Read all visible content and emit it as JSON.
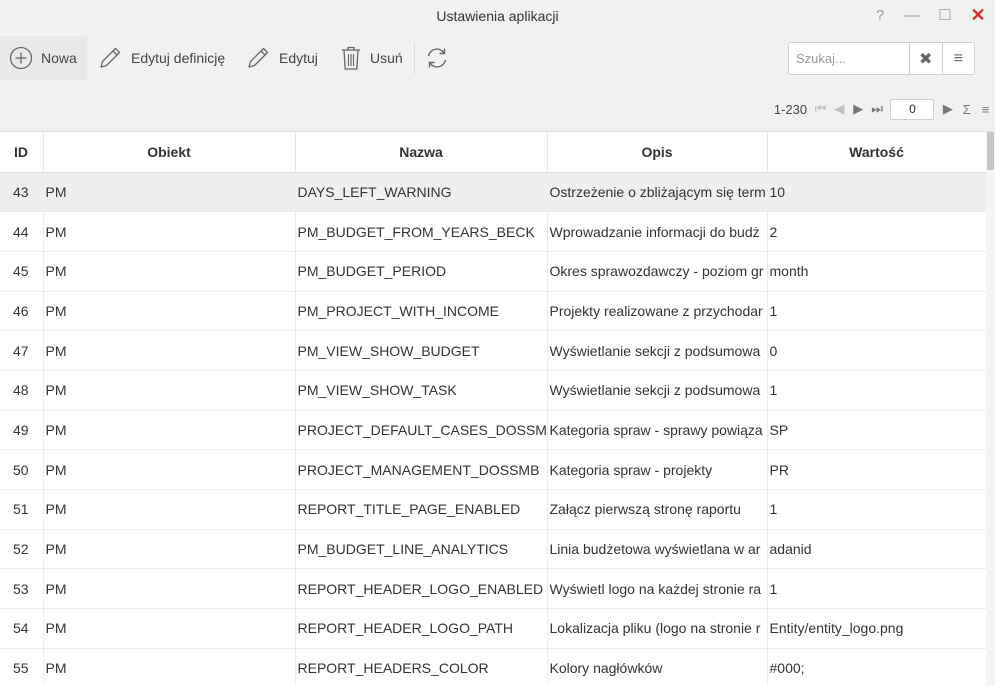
{
  "window": {
    "title": "Ustawienia aplikacji",
    "help_glyph": "?",
    "minimize_glyph": "—",
    "maximize_glyph": "☐",
    "close_glyph": "✕"
  },
  "toolbar": {
    "new_label": "Nowa",
    "edit_definition_label": "Edytuj definicję",
    "edit_label": "Edytuj",
    "delete_label": "Usuń",
    "new_icon": "plus-circle-icon",
    "edit_definition_icon": "pencil-icon",
    "edit_icon": "pencil-icon",
    "delete_icon": "trash-icon",
    "refresh_icon": "refresh-icon"
  },
  "search": {
    "placeholder": "Szukaj...",
    "value": "",
    "clear_glyph": "✖",
    "menu_glyph": "≡"
  },
  "pager": {
    "range": "1-230",
    "page": "0",
    "first_glyph": "⏮",
    "prev_glyph": "◀",
    "next_glyph": "▶",
    "last_glyph": "⏭",
    "go_glyph": "▶",
    "sum_glyph": "Σ",
    "menu_glyph": "≡"
  },
  "table": {
    "columns": [
      "ID",
      "Obiekt",
      "Nazwa",
      "Opis",
      "Wartość"
    ],
    "rows": [
      [
        "43",
        "PM",
        "DAYS_LEFT_WARNING",
        "Ostrzeżenie o zbliżającym się term",
        "10"
      ],
      [
        "44",
        "PM",
        "PM_BUDGET_FROM_YEARS_BECK",
        "Wprowadzanie informacji do budż",
        "2"
      ],
      [
        "45",
        "PM",
        "PM_BUDGET_PERIOD",
        "Okres sprawozdawczy - poziom gr",
        "month"
      ],
      [
        "46",
        "PM",
        "PM_PROJECT_WITH_INCOME",
        "Projekty realizowane z przychodar",
        "1"
      ],
      [
        "47",
        "PM",
        "PM_VIEW_SHOW_BUDGET",
        "Wyświetlanie sekcji z podsumowa",
        "0"
      ],
      [
        "48",
        "PM",
        "PM_VIEW_SHOW_TASK",
        "Wyświetlanie sekcji z podsumowa",
        "1"
      ],
      [
        "49",
        "PM",
        "PROJECT_DEFAULT_CASES_DOSSMB",
        "Kategoria spraw - sprawy powiąza",
        "SP"
      ],
      [
        "50",
        "PM",
        "PROJECT_MANAGEMENT_DOSSMB",
        "Kategoria spraw - projekty",
        "PR"
      ],
      [
        "51",
        "PM",
        "REPORT_TITLE_PAGE_ENABLED",
        "Załącz pierwszą stronę raportu",
        "1"
      ],
      [
        "52",
        "PM",
        "PM_BUDGET_LINE_ANALYTICS",
        "Linia budżetowa wyświetlana w ar",
        "adanid"
      ],
      [
        "53",
        "PM",
        "REPORT_HEADER_LOGO_ENABLED",
        "Wyświetl logo na każdej stronie ra",
        "1"
      ],
      [
        "54",
        "PM",
        "REPORT_HEADER_LOGO_PATH",
        "Lokalizacja pliku (logo na stronie r",
        "Entity/entity_logo.png"
      ],
      [
        "55",
        "PM",
        "REPORT_HEADERS_COLOR",
        "Kolory nagłówków",
        "#000;"
      ]
    ],
    "selected_row": 0
  },
  "colors": {
    "accent_close": "#d32f2f",
    "selected_row": "#efefef",
    "background": "#f1f1f1"
  }
}
